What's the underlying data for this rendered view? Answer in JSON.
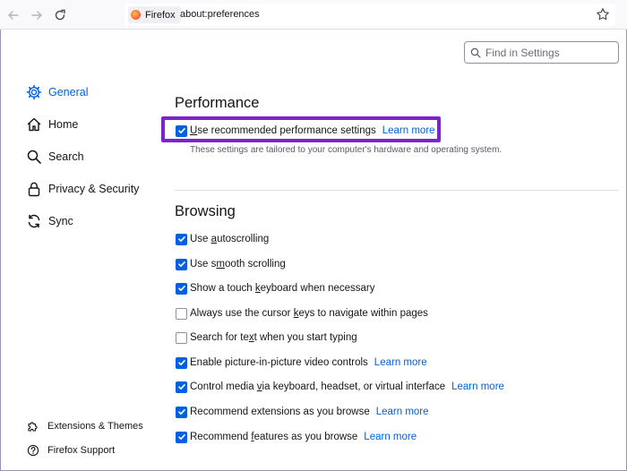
{
  "toolbar": {
    "site_name": "Firefox",
    "url": "about:preferences"
  },
  "search": {
    "placeholder": "Find in Settings"
  },
  "sidebar": {
    "items": [
      {
        "label": "General",
        "icon": "gear-icon",
        "selected": true
      },
      {
        "label": "Home",
        "icon": "home-icon"
      },
      {
        "label": "Search",
        "icon": "search-icon"
      },
      {
        "label": "Privacy & Security",
        "icon": "lock-icon"
      },
      {
        "label": "Sync",
        "icon": "sync-icon"
      }
    ],
    "footer": [
      {
        "label": "Extensions & Themes",
        "icon": "puzzle-icon"
      },
      {
        "label": "Firefox Support",
        "icon": "help-icon"
      }
    ]
  },
  "performance": {
    "heading": "Performance",
    "recommended": {
      "pre": "",
      "key": "U",
      "post": "se recommended performance settings",
      "checked": true
    },
    "learn_more": "Learn more",
    "description": "These settings are tailored to your computer's hardware and operating system."
  },
  "browsing": {
    "heading": "Browsing",
    "options": [
      {
        "pre": "Use ",
        "key": "a",
        "post": "utoscrolling",
        "checked": true,
        "link": ""
      },
      {
        "pre": "Use s",
        "key": "m",
        "post": "ooth scrolling",
        "checked": true,
        "link": ""
      },
      {
        "pre": "Show a touch ",
        "key": "k",
        "post": "eyboard when necessary",
        "checked": true,
        "link": ""
      },
      {
        "pre": "Always use the cursor ",
        "key": "k",
        "post": "eys to navigate within pages",
        "checked": false,
        "link": ""
      },
      {
        "pre": "Search for te",
        "key": "x",
        "post": "t when you start typing",
        "checked": false,
        "link": ""
      },
      {
        "pre": "Enable picture-in-picture video controls",
        "key": "",
        "post": "",
        "checked": true,
        "link": "Learn more"
      },
      {
        "pre": "Control media ",
        "key": "v",
        "post": "ia keyboard, headset, or virtual interface",
        "checked": true,
        "link": "Learn more"
      },
      {
        "pre": "Recommend extensions as you browse",
        "key": "",
        "post": "",
        "checked": true,
        "link": "Learn more"
      },
      {
        "pre": "Recommend ",
        "key": "f",
        "post": "eatures as you browse",
        "checked": true,
        "link": "Learn more"
      }
    ]
  },
  "colors": {
    "accent": "#0061e0",
    "highlight": "#7e22ce"
  }
}
